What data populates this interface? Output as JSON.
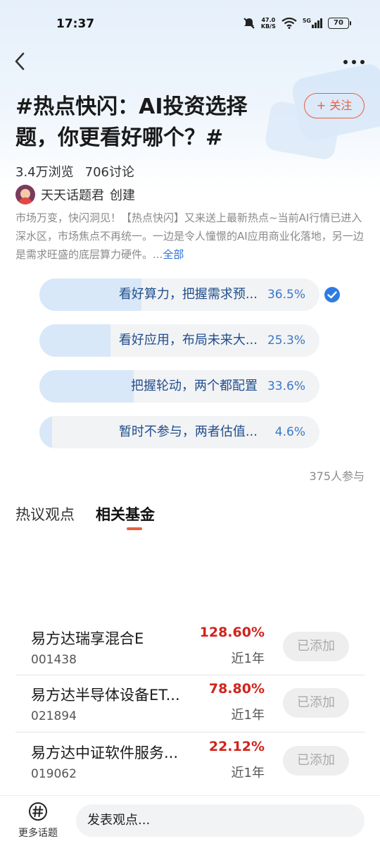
{
  "status_bar": {
    "time": "17:37",
    "net_speed_value": "47.0",
    "net_speed_unit": "KB/S",
    "network": "5G",
    "battery": "70"
  },
  "header": {
    "title": "#热点快闪：AI投资选择题，你更看好哪个？#",
    "follow_label": "+ 关注",
    "views": "3.4万浏览",
    "discussions": "706讨论",
    "creator_name": "天天话题君",
    "creator_suffix": "创建"
  },
  "description": {
    "text": "市场万变，快闪洞见！【热点快闪】又来送上最新热点~当前AI行情已进入深水区，市场焦点不再统一。一边是令人憧憬的AI应用商业化落地，另一边是需求旺盛的底层算力硬件。...",
    "more_label": "全部"
  },
  "poll": {
    "options": [
      {
        "label": "看好算力，把握需求预...",
        "percent": "36.5%",
        "value": 0.365,
        "selected": true
      },
      {
        "label": "看好应用，布局未来大...",
        "percent": "25.3%",
        "value": 0.253,
        "selected": false
      },
      {
        "label": "把握轮动，两个都配置",
        "percent": "33.6%",
        "value": 0.336,
        "selected": false
      },
      {
        "label": "暂时不参与，两者估值...",
        "percent": "4.6%",
        "value": 0.046,
        "selected": false
      }
    ],
    "participants": "375人参与"
  },
  "tabs": [
    {
      "label": "热议观点",
      "active": false
    },
    {
      "label": "相关基金",
      "active": true
    }
  ],
  "funds": [
    {
      "name": "易方达瑞享混合E",
      "code": "001438",
      "return": "128.60%",
      "period": "近1年",
      "button": "已添加"
    },
    {
      "name": "易方达半导体设备ET...",
      "code": "021894",
      "return": "78.80%",
      "period": "近1年",
      "button": "已添加"
    },
    {
      "name": "易方达中证软件服务...",
      "code": "019062",
      "return": "22.12%",
      "period": "近1年",
      "button": "已添加"
    }
  ],
  "bottom_bar": {
    "more_topics_label": "更多话题",
    "input_placeholder": "发表观点..."
  },
  "colors": {
    "accent": "#e8603c",
    "link": "#2f6fd8",
    "poll_fill": "#d8e8f8",
    "return_red": "#d0241c"
  }
}
